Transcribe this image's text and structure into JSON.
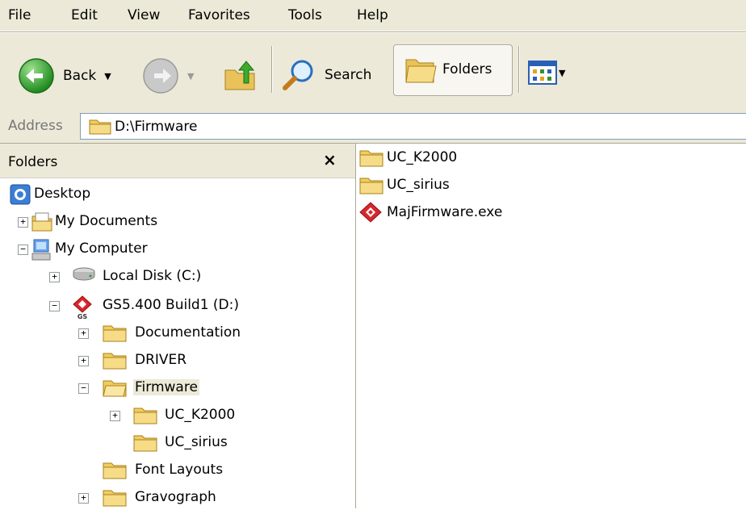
{
  "menu": [
    "File",
    "Edit",
    "View",
    "Favorites",
    "Tools",
    "Help"
  ],
  "toolbar": {
    "back_label": "Back",
    "search_label": "Search",
    "folders_label": "Folders"
  },
  "address": {
    "label": "Address",
    "value": "D:\\Firmware"
  },
  "folders_pane": {
    "title": "Folders",
    "close": "×"
  },
  "tree": [
    {
      "label": "Desktop",
      "icon": "desktop-icon",
      "expander": ""
    },
    {
      "label": "My Documents",
      "icon": "my-documents-icon",
      "expander": "+"
    },
    {
      "label": "My Computer",
      "icon": "my-computer-icon",
      "expander": "−"
    },
    {
      "label": "Local Disk (C:)",
      "icon": "local-disk-icon",
      "expander": "+"
    },
    {
      "label": "GS5.400 Build1 (D:)",
      "icon": "gs-drive-icon",
      "expander": "−"
    },
    {
      "label": "Documentation",
      "icon": "folder-icon",
      "expander": "+"
    },
    {
      "label": "DRIVER",
      "icon": "folder-icon",
      "expander": "+"
    },
    {
      "label": "Firmware",
      "icon": "folder-open-icon",
      "expander": "−",
      "selected": true
    },
    {
      "label": "UC_K2000",
      "icon": "folder-icon",
      "expander": "+"
    },
    {
      "label": "UC_sirius",
      "icon": "folder-icon",
      "expander": ""
    },
    {
      "label": "Font Layouts",
      "icon": "folder-icon",
      "expander": ""
    },
    {
      "label": "Gravograph",
      "icon": "folder-icon",
      "expander": "+"
    }
  ],
  "files": [
    {
      "name": "UC_K2000",
      "icon": "folder-icon"
    },
    {
      "name": "UC_sirius",
      "icon": "folder-icon"
    },
    {
      "name": "MajFirmware.exe",
      "icon": "gs-exe-icon"
    }
  ]
}
